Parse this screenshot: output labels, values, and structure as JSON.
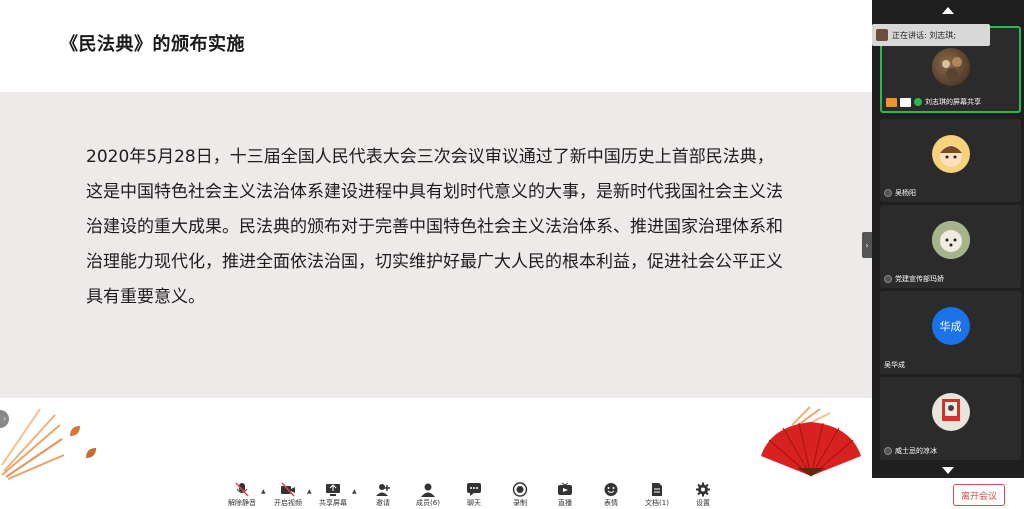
{
  "slide": {
    "title": "《民法典》的颁布实施",
    "body": "2020年5月28日，十三届全国人民代表大会三次会议审议通过了新中国历史上首部民法典，这是中国特色社会主义法治体系建设进程中具有划时代意义的大事，是新时代我国社会主义法治建设的重大成果。民法典的颁布对于完善中国特色社会主义法治体系、推进国家治理体系和治理能力现代化，推进全面依法治国，切实维护好最广大人民的根本利益，促进社会公平正义具有重要意义。"
  },
  "panel": {
    "speaking_label": "正在讲话: 刘志琪;",
    "tiles": [
      {
        "name": "刘志琪的屏幕共享",
        "avatar_icon": "cat-photo-avatar"
      },
      {
        "name": "吴杨阳",
        "avatar_icon": "cartoon-boy-avatar"
      },
      {
        "name": "党建宣传部玛娇",
        "avatar_icon": "puppy-photo-avatar"
      },
      {
        "name": "吴华成",
        "avatar_text": "华成",
        "avatar_color": "#1a73e8"
      },
      {
        "name": "威士忌的凉冰",
        "avatar_icon": "framed-portrait-avatar"
      }
    ]
  },
  "toolbar": {
    "items": [
      {
        "label": "解除静音",
        "icon": "mic-muted-icon"
      },
      {
        "label": "开启视频",
        "icon": "video-off-icon"
      },
      {
        "label": "共享屏幕",
        "icon": "share-screen-icon"
      },
      {
        "label": "邀请",
        "icon": "invite-icon"
      },
      {
        "label": "成员(6)",
        "icon": "members-icon"
      },
      {
        "label": "聊天",
        "icon": "chat-icon"
      },
      {
        "label": "录制",
        "icon": "record-icon"
      },
      {
        "label": "直播",
        "icon": "live-icon"
      },
      {
        "label": "表情",
        "icon": "emoji-icon"
      },
      {
        "label": "文档(1)",
        "icon": "document-icon"
      },
      {
        "label": "设置",
        "icon": "settings-icon"
      }
    ],
    "leave_label": "离开会议"
  },
  "colors": {
    "accent_red": "#e04848",
    "active_green": "#2db84d",
    "band": "#efeaea",
    "panel_bg": "#1f1f1f"
  }
}
